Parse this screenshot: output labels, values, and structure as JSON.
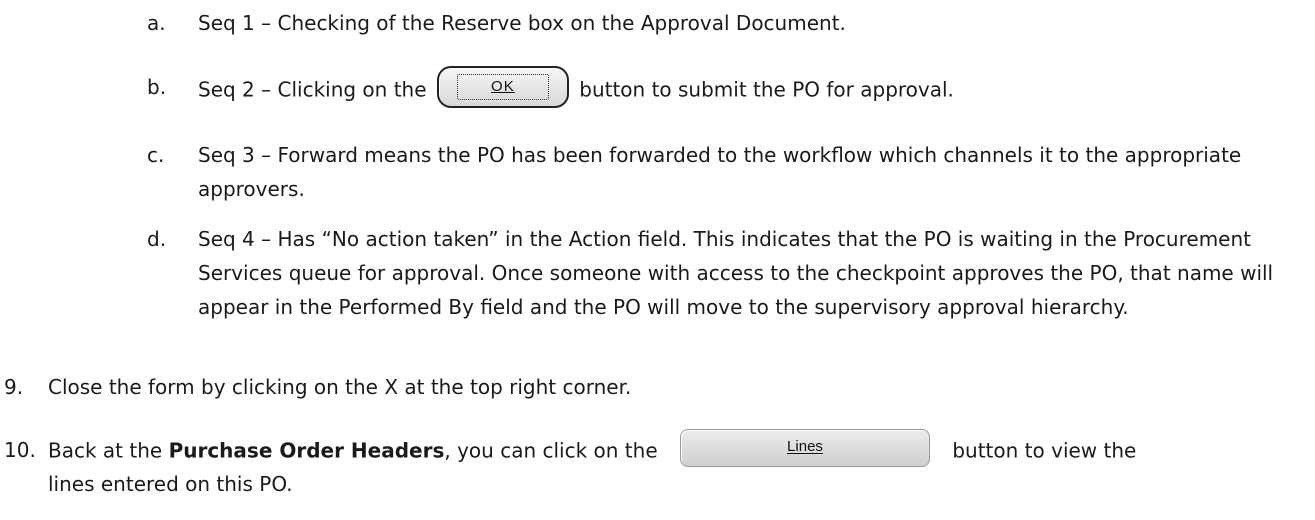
{
  "items": {
    "a": {
      "marker": "a.",
      "text": "Seq 1 – Checking of the Reserve box on the Approval Document."
    },
    "b": {
      "marker": "b.",
      "before": "Seq 2 – Clicking on the",
      "button": "OK",
      "after": "button to submit the PO for approval."
    },
    "c": {
      "marker": "c.",
      "text": "Seq 3 – Forward means the PO has been forwarded to the workflow which channels it to the appropriate approvers."
    },
    "d": {
      "marker": "d.",
      "text": "Seq 4 – Has “No action taken” in the Action field.  This indicates that the PO is waiting in the Procurement Services queue for approval. Once someone with access to the checkpoint approves the PO, that name will appear in the Performed By field and the PO will move to the supervisory approval hierarchy."
    }
  },
  "steps": {
    "s9": {
      "marker": "9.",
      "text": "Close the form by clicking on the X at the top right corner."
    },
    "s10": {
      "marker": "10.",
      "before": "Back at the",
      "bold": "Purchase Order Headers",
      "middle": ", you can click on the",
      "button": "Lines",
      "after": "button to view the",
      "line2": "lines entered on this PO."
    }
  }
}
